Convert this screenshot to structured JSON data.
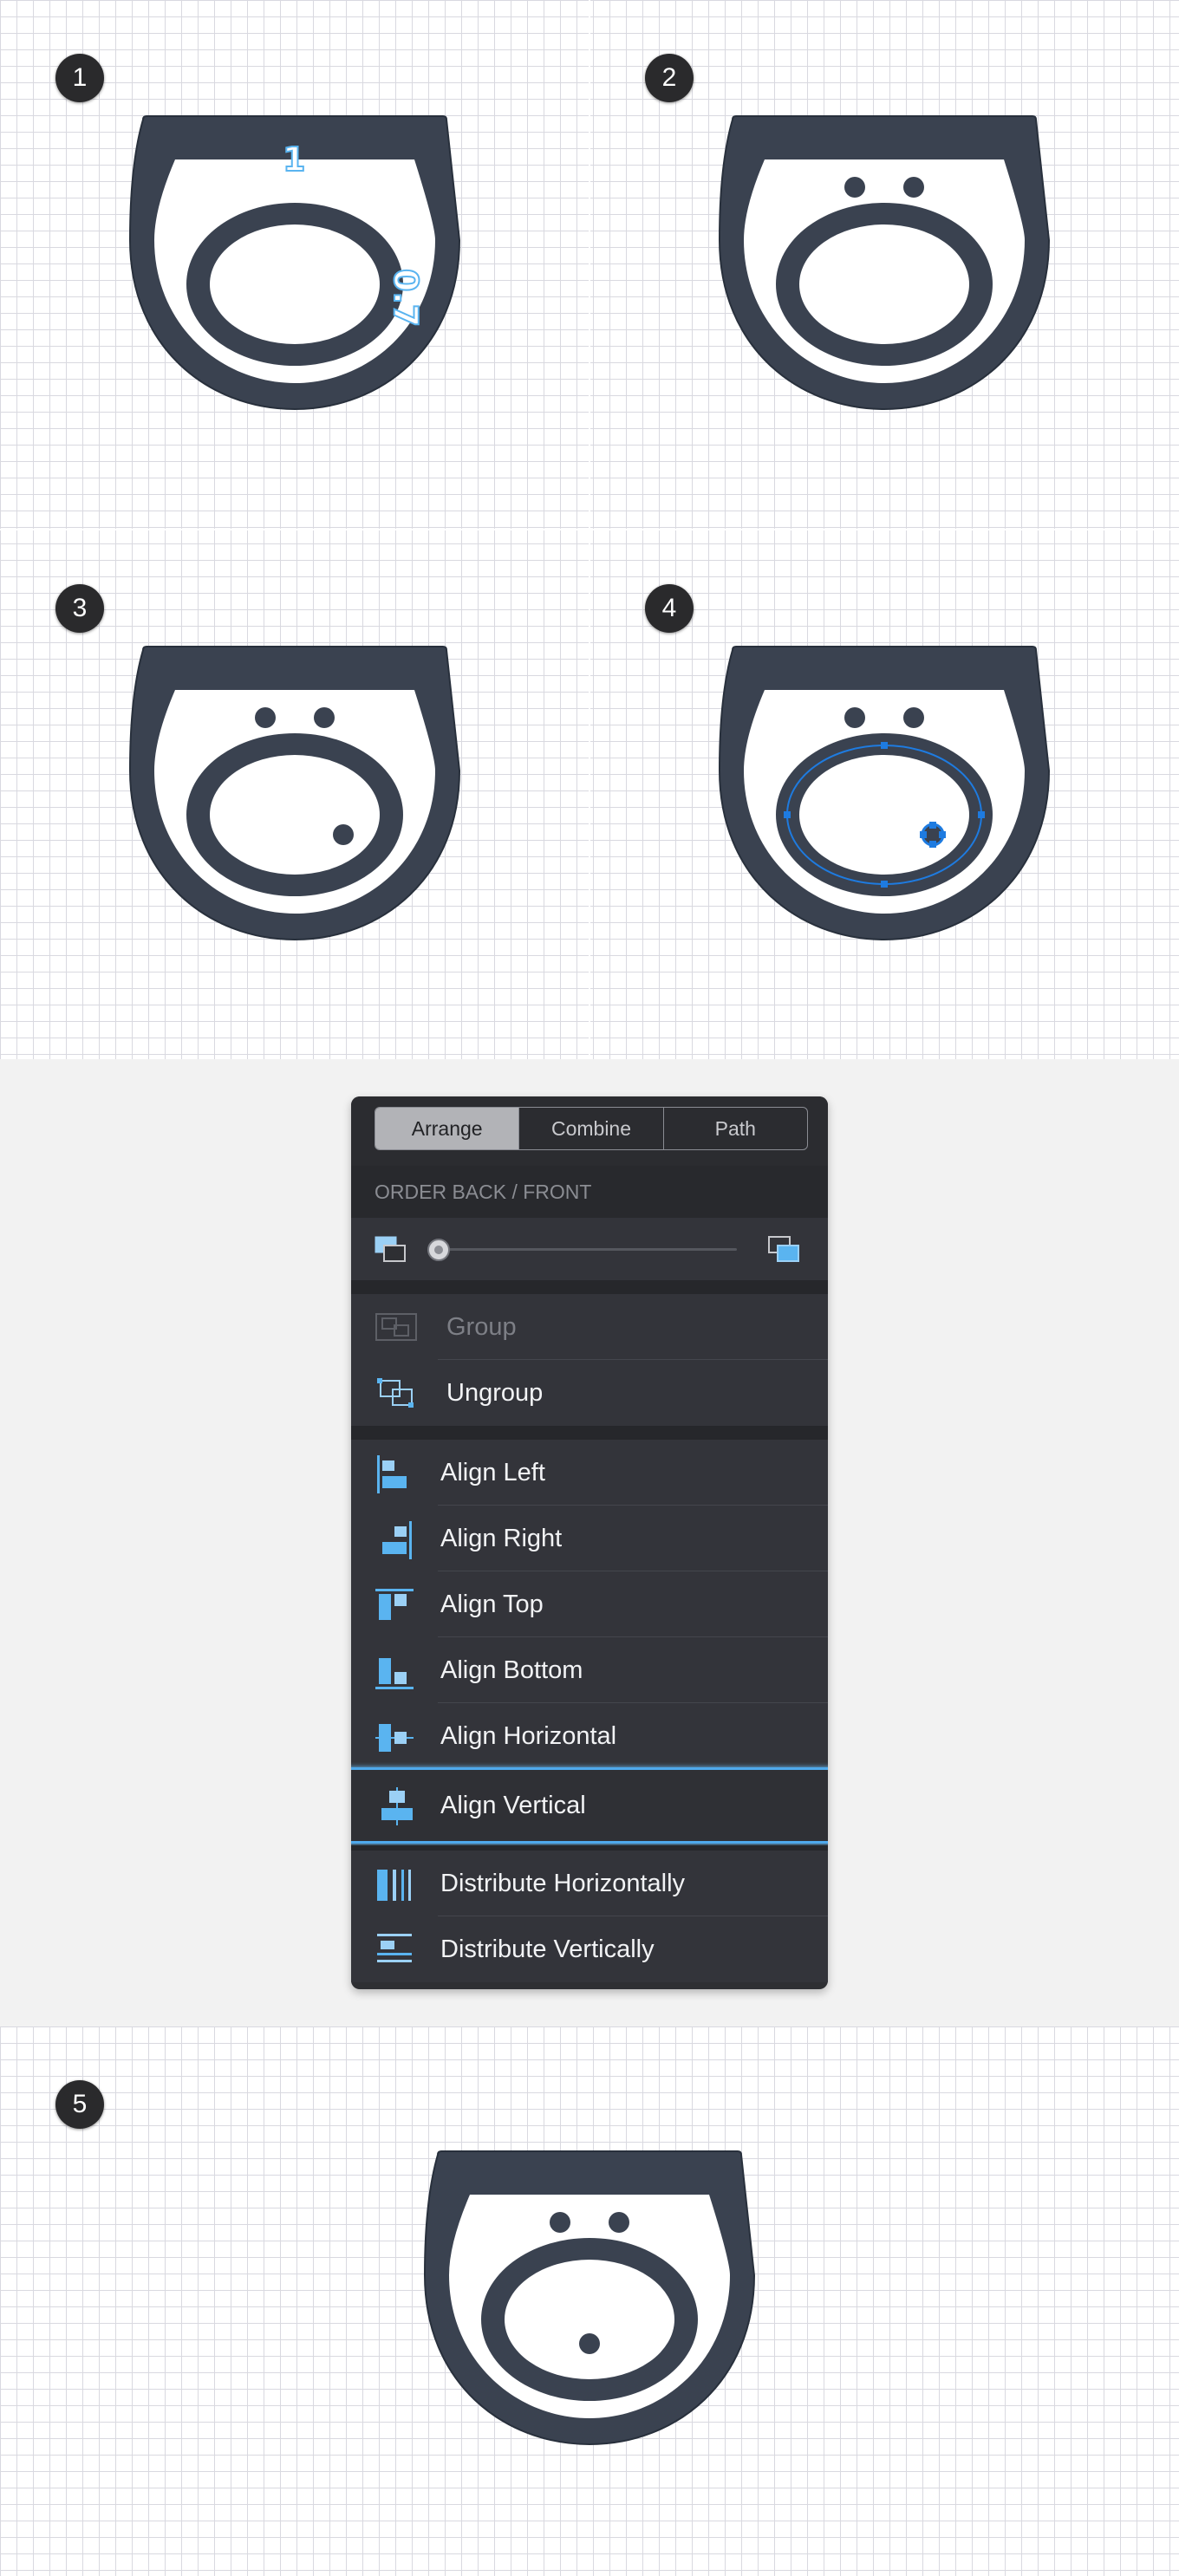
{
  "steps": [
    {
      "number": "1",
      "dimensions": {
        "width": "1",
        "height": "0.7"
      }
    },
    {
      "number": "2"
    },
    {
      "number": "3"
    },
    {
      "number": "4"
    },
    {
      "number": "5"
    }
  ],
  "colors": {
    "shape": "#3a4250",
    "dimension_accent": "#5ab4f0",
    "selection": "#1e7be0",
    "highlight_border": "#4fa9ec",
    "panel_bg": "#2e2f33"
  },
  "menu": {
    "tabs": [
      {
        "label": "Arrange",
        "active": true
      },
      {
        "label": "Combine",
        "active": false
      },
      {
        "label": "Path",
        "active": false
      }
    ],
    "order_header": "ORDER BACK / FRONT",
    "order_slider_value": 0,
    "group_items": [
      {
        "label": "Group",
        "icon": "group-icon",
        "enabled": false
      },
      {
        "label": "Ungroup",
        "icon": "ungroup-icon",
        "enabled": true
      }
    ],
    "align_items": [
      {
        "label": "Align Left",
        "icon": "align-left-icon"
      },
      {
        "label": "Align Right",
        "icon": "align-right-icon"
      },
      {
        "label": "Align Top",
        "icon": "align-top-icon"
      },
      {
        "label": "Align Bottom",
        "icon": "align-bottom-icon"
      },
      {
        "label": "Align Horizontal",
        "icon": "align-horizontal-icon"
      },
      {
        "label": "Align Vertical",
        "icon": "align-vertical-icon",
        "highlighted": true
      }
    ],
    "distribute_items": [
      {
        "label": "Distribute Horizontally",
        "icon": "distribute-horizontally-icon"
      },
      {
        "label": "Distribute Vertically",
        "icon": "distribute-vertically-icon"
      }
    ]
  }
}
